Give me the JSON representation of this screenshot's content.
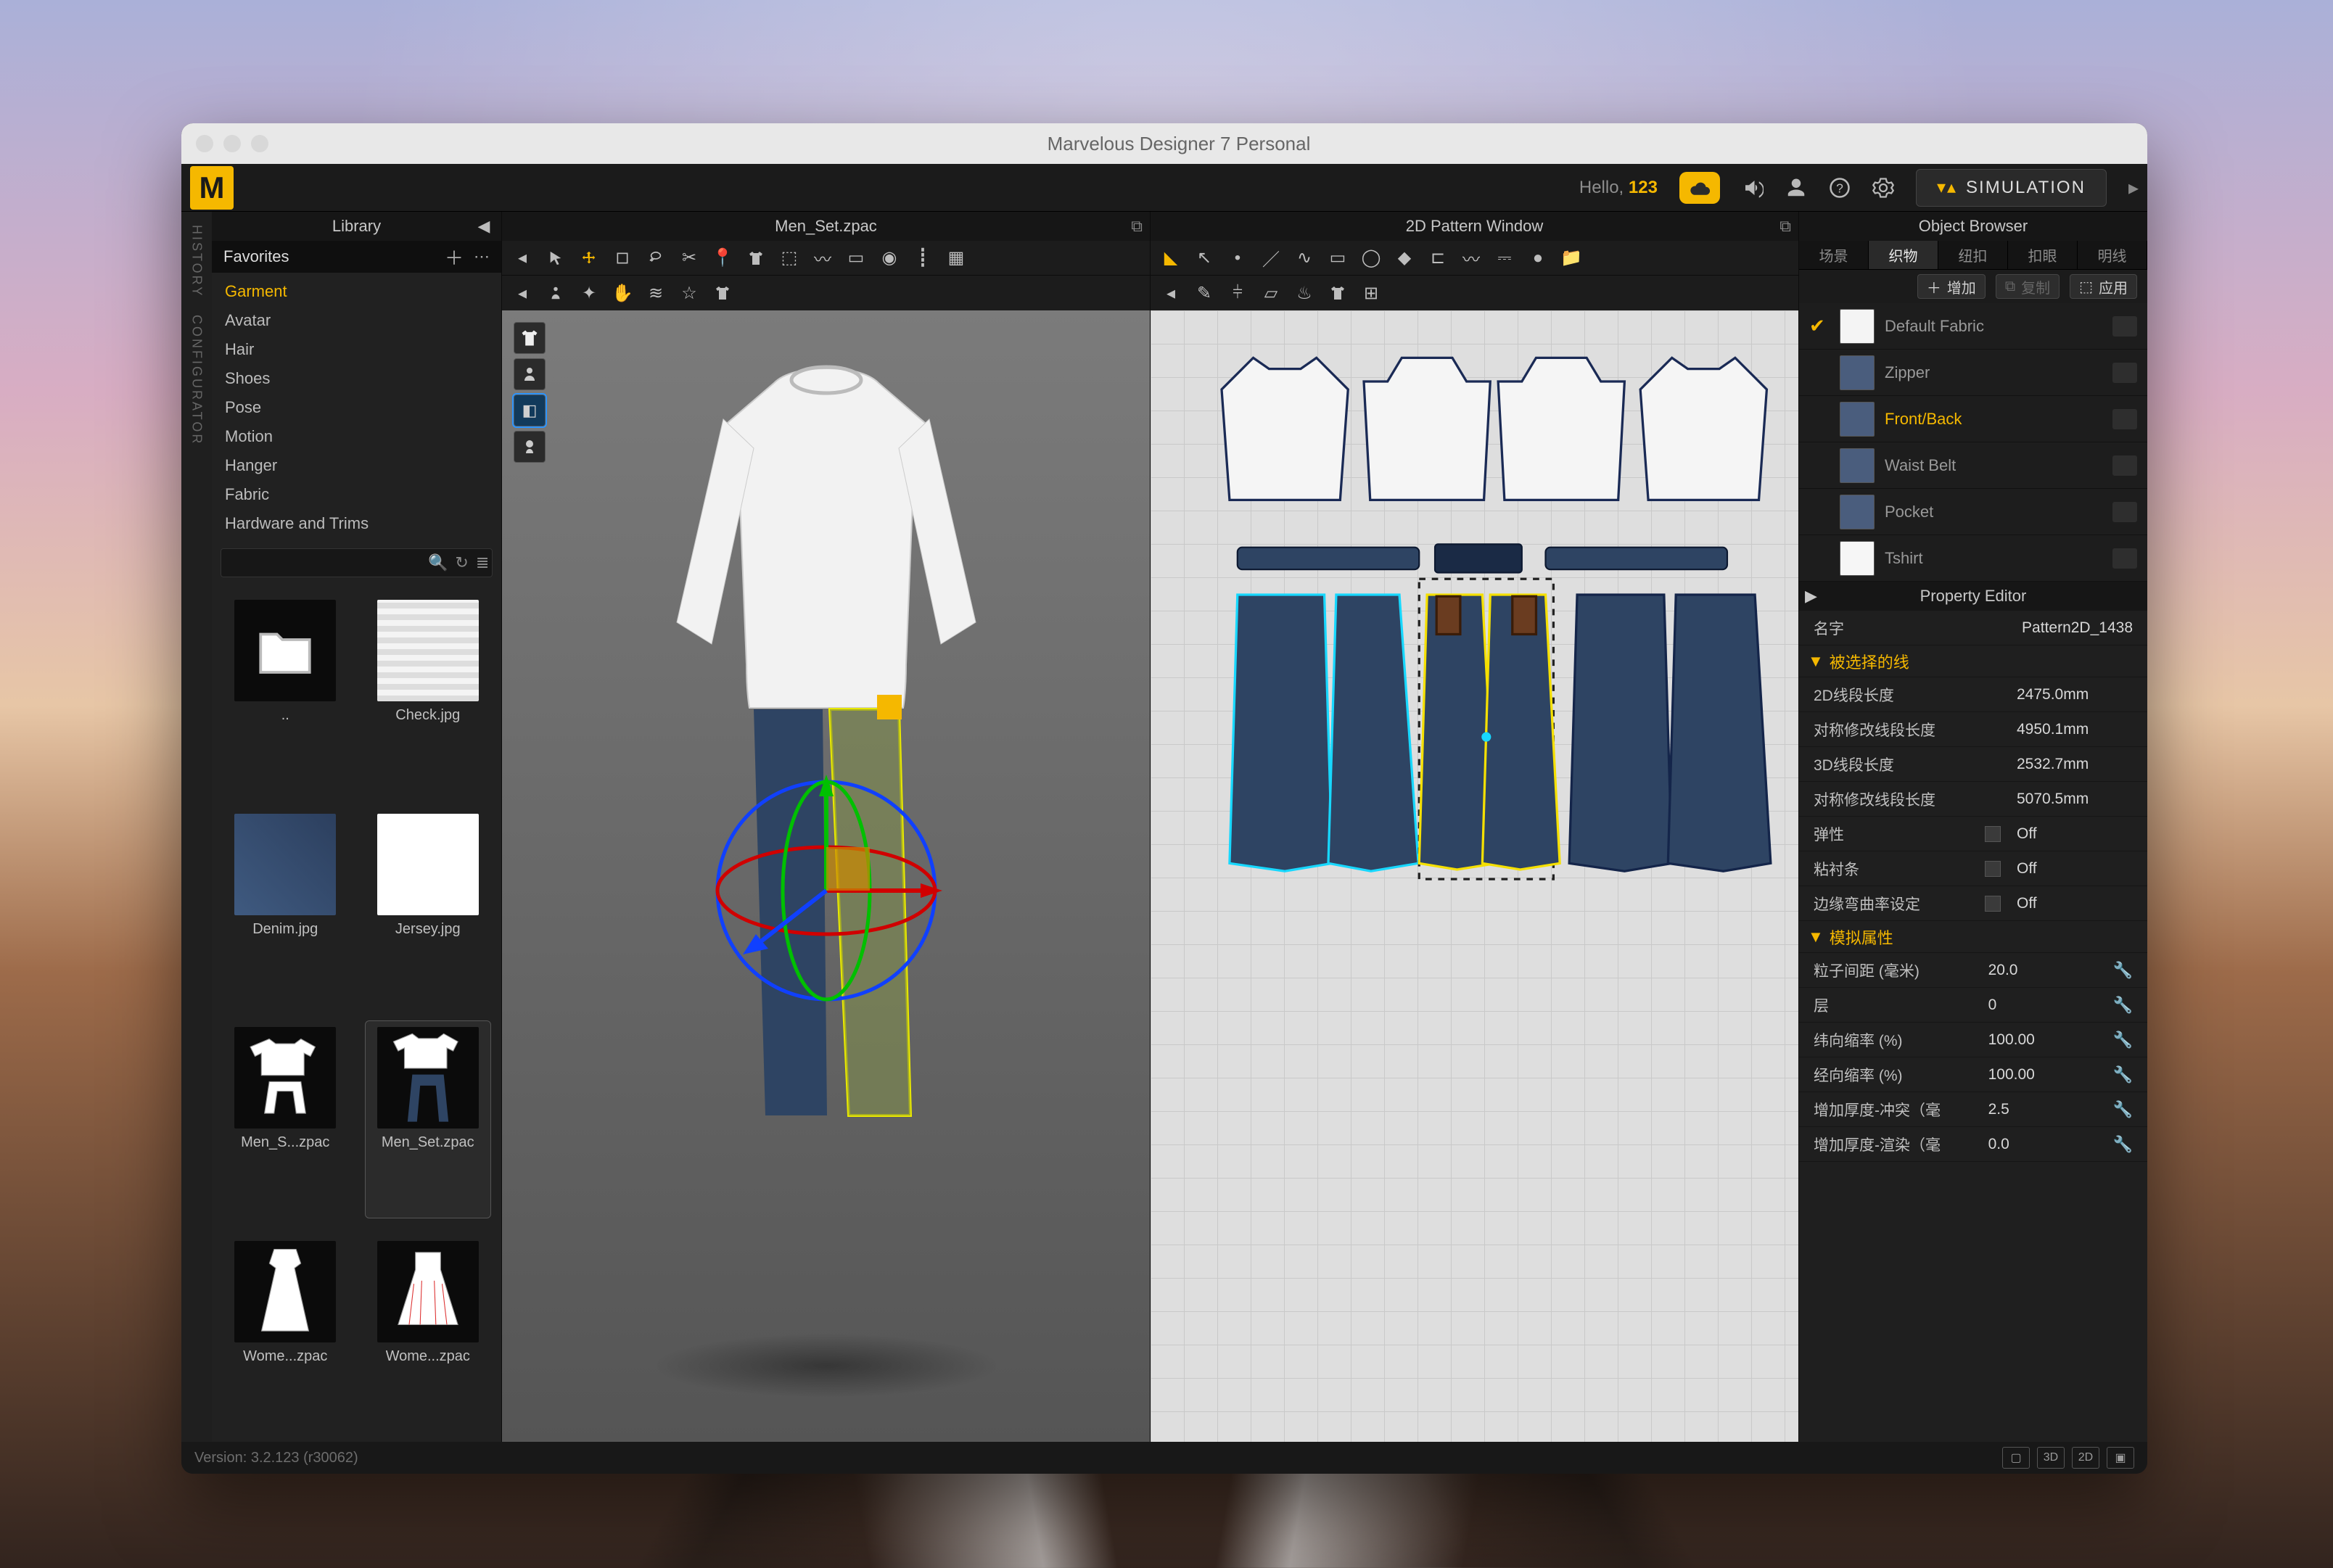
{
  "window": {
    "title": "Marvelous Designer 7 Personal"
  },
  "topbar": {
    "hello_prefix": "Hello, ",
    "hello_user": "123",
    "simulation": "SIMULATION"
  },
  "sidetabs": {
    "history": "HISTORY",
    "configurator": "CONFIGURATOR"
  },
  "library": {
    "title": "Library",
    "favorites": "Favorites",
    "items": [
      {
        "label": "Garment",
        "active": true
      },
      {
        "label": "Avatar"
      },
      {
        "label": "Hair"
      },
      {
        "label": "Shoes"
      },
      {
        "label": "Pose"
      },
      {
        "label": "Motion"
      },
      {
        "label": "Hanger"
      },
      {
        "label": "Fabric"
      },
      {
        "label": "Hardware and Trims"
      }
    ],
    "search_placeholder": "",
    "grid": [
      {
        "label": "..",
        "kind": "folder"
      },
      {
        "label": "Check.jpg",
        "kind": "check"
      },
      {
        "label": "Denim.jpg",
        "kind": "denim"
      },
      {
        "label": "Jersey.jpg",
        "kind": "white"
      },
      {
        "label": "Men_S...zpac",
        "kind": "gshorts"
      },
      {
        "label": "Men_Set.zpac",
        "kind": "gjeans",
        "selected": true
      },
      {
        "label": "Wome...zpac",
        "kind": "gdress"
      },
      {
        "label": "Wome...zpac",
        "kind": "gskirt"
      }
    ]
  },
  "vp3d": {
    "title": "Men_Set.zpac"
  },
  "vp2d": {
    "title": "2D Pattern Window"
  },
  "objectBrowser": {
    "title": "Object Browser",
    "tabs": [
      {
        "label": "场景"
      },
      {
        "label": "织物",
        "active": true
      },
      {
        "label": "纽扣"
      },
      {
        "label": "扣眼"
      },
      {
        "label": "明线"
      }
    ],
    "actions": {
      "add": "增加",
      "copy": "复制",
      "apply": "应用"
    },
    "rows": [
      {
        "name": "Default Fabric",
        "color": "#f4f4f4",
        "checked": true
      },
      {
        "name": "Zipper",
        "color": "#4a5d7d"
      },
      {
        "name": "Front/Back",
        "color": "#4a5d7d",
        "active": true
      },
      {
        "name": "Waist Belt",
        "color": "#4a5d7d"
      },
      {
        "name": "Pocket",
        "color": "#4a5d7d"
      },
      {
        "name": "Tshirt",
        "color": "#f6f6f6"
      }
    ]
  },
  "propertyEditor": {
    "title": "Property Editor",
    "nameKey": "名字",
    "nameVal": "Pattern2D_1438",
    "sections": [
      {
        "title": "被选择的线",
        "rows": [
          {
            "k": "2D线段长度",
            "v": "2475.0mm"
          },
          {
            "k": "对称修改线段长度",
            "v": "4950.1mm"
          },
          {
            "k": "3D线段长度",
            "v": "2532.7mm"
          },
          {
            "k": "对称修改线段长度",
            "v": "5070.5mm"
          },
          {
            "k": "弹性",
            "v": "Off",
            "toggle": true
          },
          {
            "k": "粘衬条",
            "v": "Off",
            "toggle": true
          },
          {
            "k": "边缘弯曲率设定",
            "v": "Off",
            "toggle": true
          }
        ]
      },
      {
        "title": "模拟属性",
        "rows": [
          {
            "k": "粒子间距 (毫米)",
            "v": "20.0",
            "wrench": true
          },
          {
            "k": "层",
            "v": "0",
            "wrench": true
          },
          {
            "k": "纬向缩率 (%)",
            "v": "100.00",
            "wrench": true
          },
          {
            "k": "经向缩率 (%)",
            "v": "100.00",
            "wrench": true
          },
          {
            "k": "增加厚度-冲突（毫",
            "v": "2.5",
            "wrench": true
          },
          {
            "k": "增加厚度-渲染（毫",
            "v": "0.0",
            "wrench": true
          }
        ]
      }
    ]
  },
  "status": {
    "version": "Version: 3.2.123    (r30062)",
    "views": [
      "▢",
      "3D",
      "2D",
      "▣"
    ]
  }
}
